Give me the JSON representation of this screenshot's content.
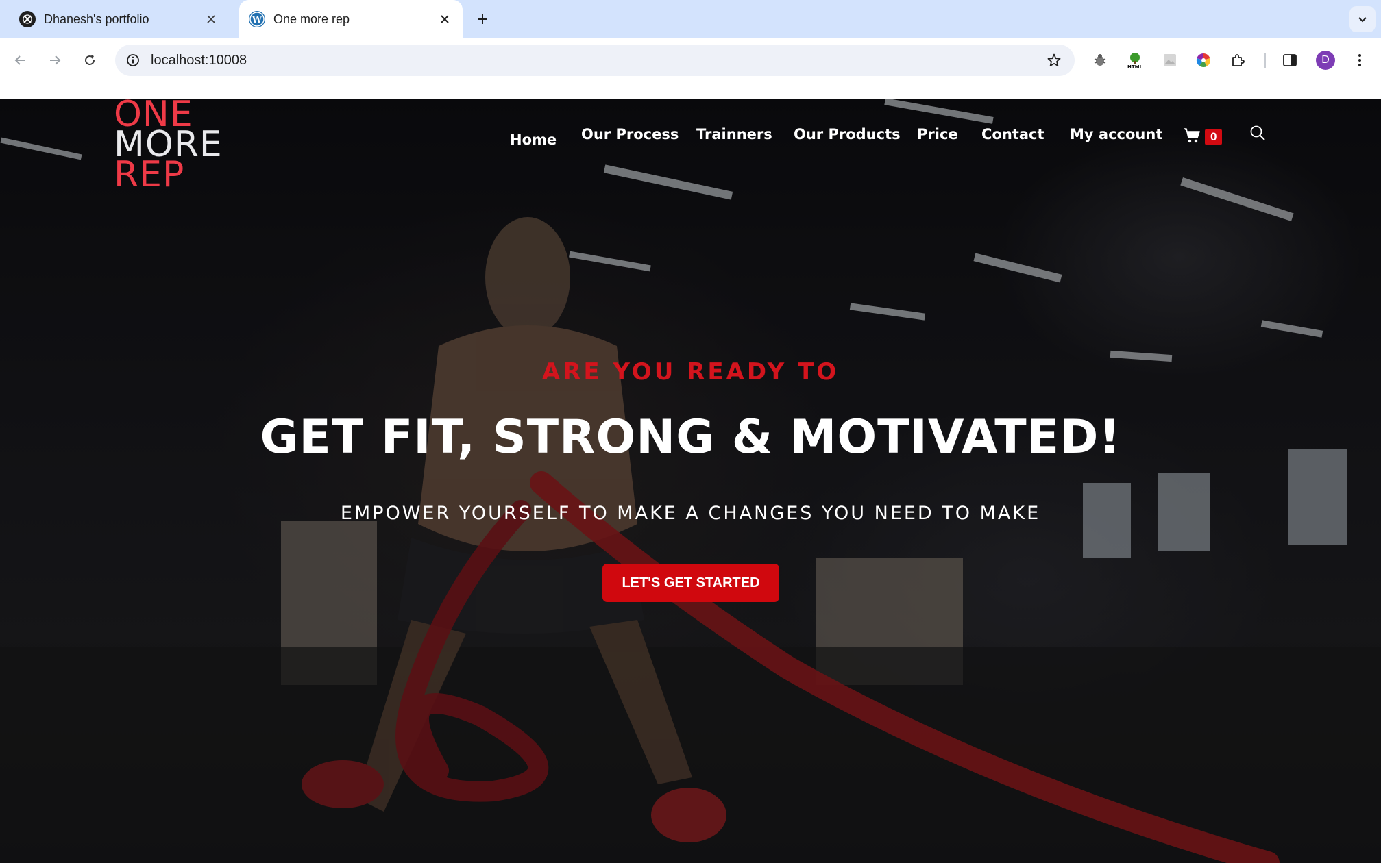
{
  "browser": {
    "tabs": [
      {
        "title": "Dhanesh's portfolio",
        "favicon": "portfolio-favicon",
        "active": false
      },
      {
        "title": "One more rep",
        "favicon": "wordpress-icon",
        "active": true
      }
    ],
    "url": "localhost:10008",
    "profile_initial": "D"
  },
  "site": {
    "logo": {
      "line1": "ONE",
      "line2": "MORE",
      "line3": "REP"
    },
    "nav": [
      {
        "label": "Home"
      },
      {
        "label": "Our Process"
      },
      {
        "label": "Trainners"
      },
      {
        "label": "Our Products"
      },
      {
        "label": "Price"
      },
      {
        "label": "Contact"
      },
      {
        "label": "My account"
      }
    ],
    "cart_count": "0",
    "hero": {
      "kicker": "ARE YOU READY TO",
      "headline": "GET FIT, STRONG & MOTIVATED!",
      "subline": "EMPOWER YOURSELF TO MAKE A CHANGES YOU NEED TO MAKE",
      "cta_label": "LET'S GET STARTED"
    }
  },
  "colors": {
    "brand_red": "#ee3a47",
    "cta_red": "#d0080e",
    "tabstrip": "#d3e3fd"
  }
}
